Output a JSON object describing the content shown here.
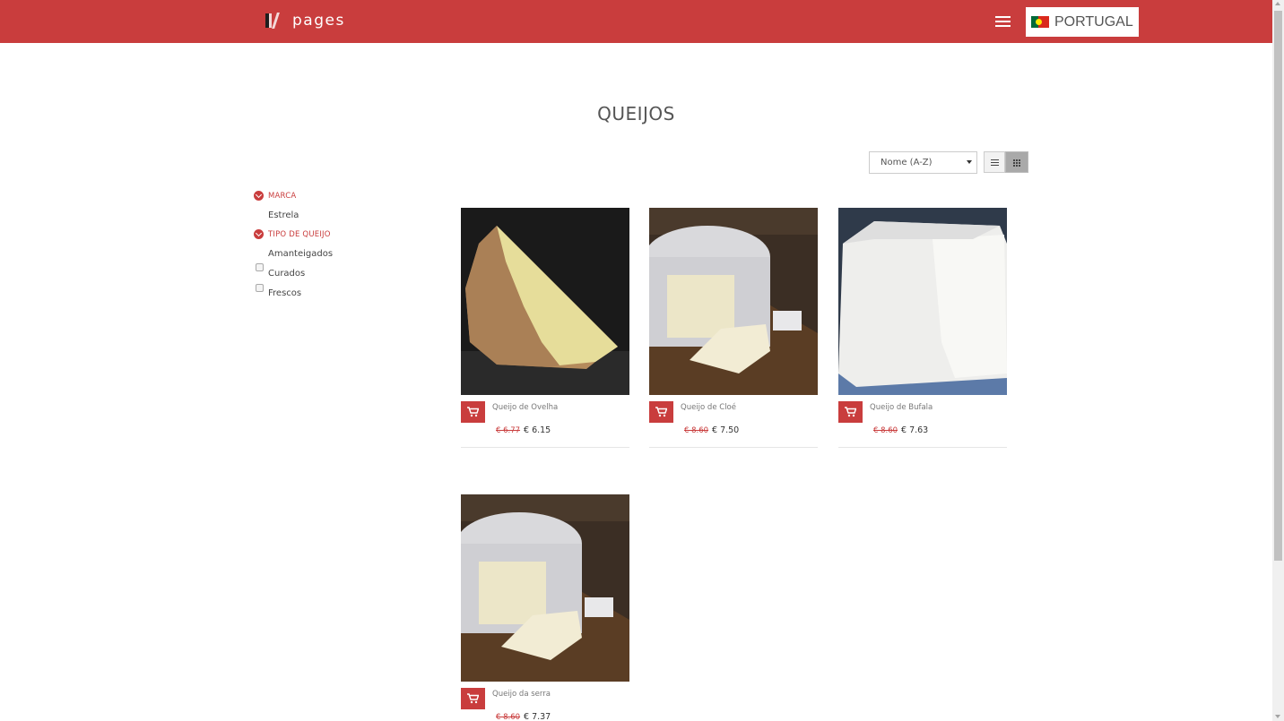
{
  "header": {
    "logo_text": "pages",
    "country_label": "PORTUGAL"
  },
  "page": {
    "title": "QUEIJOS"
  },
  "toolbar": {
    "sort_selected": "Nome (A-Z)"
  },
  "filters": {
    "groups": [
      {
        "label": "MARCA",
        "options": [
          {
            "label": "Estrela"
          }
        ]
      },
      {
        "label": "TIPO DE QUEIJO",
        "options": [
          {
            "label": "Amanteigados"
          },
          {
            "label": "Curados"
          },
          {
            "label": "Frescos"
          }
        ]
      }
    ]
  },
  "products": [
    {
      "name": "Queijo de Ovelha",
      "old_price": "€ 6.77",
      "price": "€ 6.15"
    },
    {
      "name": "Queijo de Cloé",
      "old_price": "€ 8.60",
      "price": "€ 7.50"
    },
    {
      "name": "Queijo de Bufala",
      "old_price": "€ 8.60",
      "price": "€ 7.63"
    },
    {
      "name": "Queijo da serra",
      "old_price": "€ 8.60",
      "price": "€ 7.37"
    }
  ],
  "colors": {
    "brand_red": "#c93d3d"
  }
}
